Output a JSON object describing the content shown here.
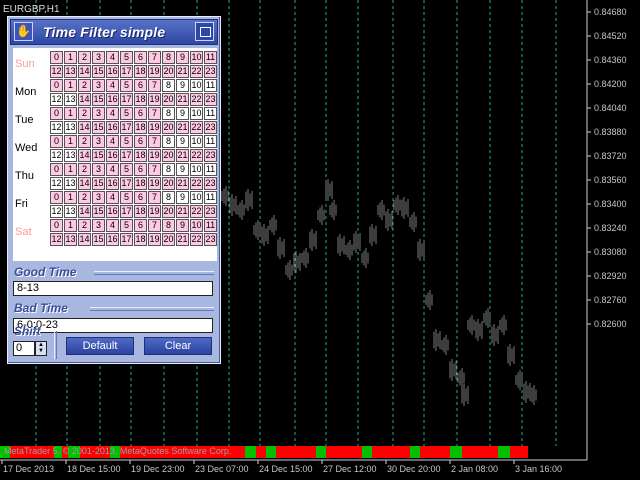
{
  "chart": {
    "symbol": "EURGBP,H1",
    "price_levels": [
      "0.84680",
      "0.84520",
      "0.84360",
      "0.84200",
      "0.84040",
      "0.83880",
      "0.83720",
      "0.83560",
      "0.83400",
      "0.83240",
      "0.83080",
      "0.82920",
      "0.82760",
      "0.82600"
    ],
    "time_labels": [
      "17 Dec 2013",
      "18 Dec 15:00",
      "19 Dec 23:00",
      "23 Dec 07:00",
      "24 Dec 15:00",
      "27 Dec 12:00",
      "30 Dec 20:00",
      "2 Jan 08:00",
      "3 Jan 16:00"
    ],
    "copyright": "MetaTrader 5, © 2001-2013, MetaQuotes Software Corp.",
    "colors": {
      "bars": "#7a7a7a",
      "gridline": "#1faa8c",
      "good": "#00c000",
      "bad": "#ff0000"
    }
  },
  "panel": {
    "title": "Time Filter simple",
    "title_icon": "hand-icon",
    "days": [
      {
        "label": "Sun",
        "weekend": true
      },
      {
        "label": "Mon",
        "weekend": false
      },
      {
        "label": "Tue",
        "weekend": false
      },
      {
        "label": "Wed",
        "weekend": false
      },
      {
        "label": "Thu",
        "weekend": false
      },
      {
        "label": "Fri",
        "weekend": false
      },
      {
        "label": "Sat",
        "weekend": true
      }
    ],
    "hours": [
      0,
      1,
      2,
      3,
      4,
      5,
      6,
      7,
      8,
      9,
      10,
      11,
      12,
      13,
      14,
      15,
      16,
      17,
      18,
      19,
      20,
      21,
      22,
      23
    ],
    "highlighted_hours_weekday": [
      8,
      9,
      10,
      11,
      12,
      13
    ],
    "good_time_label": "Good Time",
    "good_time_value": "8-13",
    "bad_time_label": "Bad Time",
    "bad_time_value": "6-0:0-23",
    "shift_label": "Shift",
    "shift_value": "0",
    "default_label": "Default",
    "clear_label": "Clear"
  }
}
